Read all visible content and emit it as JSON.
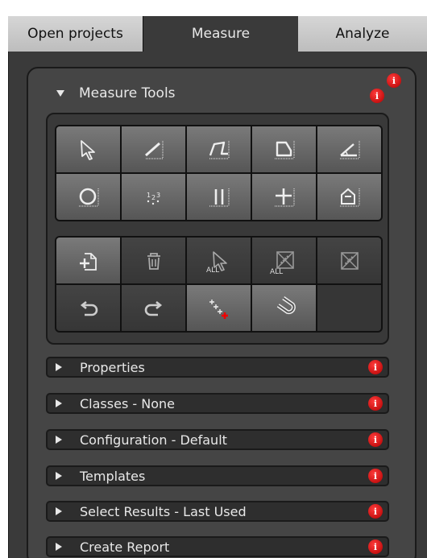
{
  "tabs": [
    {
      "label": "Open projects",
      "active": false
    },
    {
      "label": "Measure",
      "active": true
    },
    {
      "label": "Analyze",
      "active": false
    }
  ],
  "measure_tools": {
    "title": "Measure Tools",
    "info_glyph": "i",
    "row1": [
      "select-arrow-icon",
      "line-icon",
      "polyline-icon",
      "polygon-icon",
      "angle-icon"
    ],
    "row2": [
      "circle-icon",
      "point-count-icon",
      "parallel-lines-icon",
      "crosshair-icon",
      "point-shape-icon"
    ],
    "row3": [
      "new-measurement-icon",
      "delete-icon",
      "select-all-icon",
      "deselect-all-icon",
      "clear-icon"
    ],
    "row4": [
      "undo-icon",
      "redo-icon",
      "add-points-icon",
      "magnet-icon",
      "empty"
    ],
    "all_label": "ALL"
  },
  "sections": [
    {
      "label": "Properties"
    },
    {
      "label": "Classes - None"
    },
    {
      "label": "Configuration - Default"
    },
    {
      "label": "Templates"
    },
    {
      "label": "Select Results - Last Used"
    },
    {
      "label": "Create Report"
    }
  ],
  "colors": {
    "info_red": "#d40000",
    "panel": "#3a3a3a",
    "button_light": "#6a6a6a",
    "button_dark": "#3d3d3d"
  }
}
